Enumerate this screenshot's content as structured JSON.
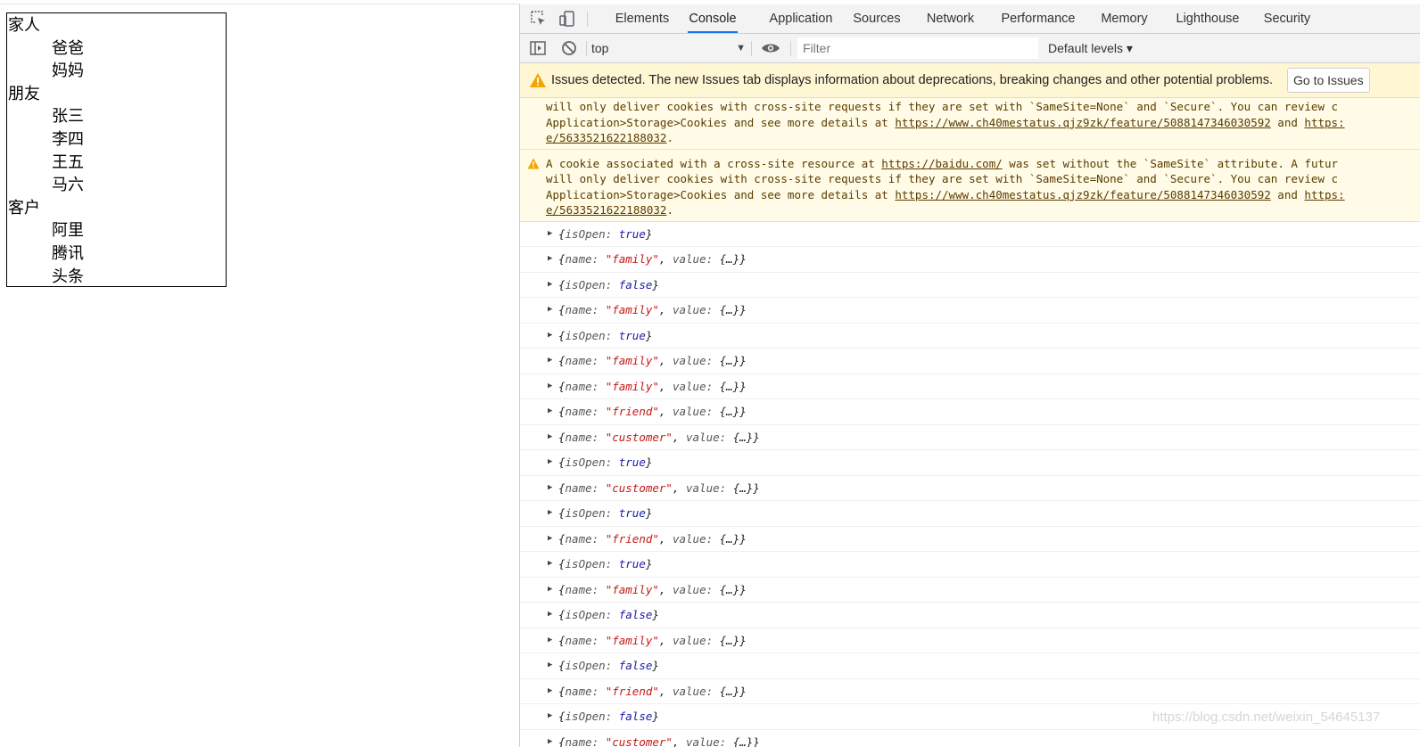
{
  "page": {
    "tree": {
      "groups": [
        {
          "label": "家人",
          "members": [
            "爸爸",
            "妈妈"
          ]
        },
        {
          "label": "朋友",
          "members": [
            "张三",
            "李四",
            "王五",
            "马六"
          ]
        },
        {
          "label": "客户",
          "members": [
            "阿里",
            "腾讯",
            "头条"
          ]
        }
      ]
    }
  },
  "devtools": {
    "tabs": [
      "Elements",
      "Console",
      "Application",
      "Sources",
      "Network",
      "Performance",
      "Memory",
      "Lighthouse",
      "Security"
    ],
    "active_tab": "Console",
    "toolbar": {
      "context": "top",
      "filter_placeholder": "Filter",
      "levels": "Default levels ▾"
    },
    "issues_bar": {
      "text": "Issues detected. The new Issues tab displays information about deprecations, breaking changes and other potential problems.",
      "button": "Go to Issues"
    },
    "warnings": [
      {
        "lines": [
          "will only deliver cookies with cross-site requests if they are set with `SameSite=None` and `Secure`. You can review c",
          "Application>Storage>Cookies and see more details at |https://www.ch40mestatus.qjz9zk/feature/5088147346030592| and |https:",
          "|e/5633521622188032|."
        ]
      },
      {
        "lines": [
          "A cookie associated with a cross-site resource at |https://baidu.com/| was set without the `SameSite` attribute. A futur",
          "will only deliver cookies with cross-site requests if they are set with `SameSite=None` and `Secure`. You can review c",
          "Application>Storage>Cookies and see more details at |https://www.ch40mestatus.qjz9zk/feature/5088147346030592| and |https:",
          "|e/5633521622188032|."
        ]
      }
    ],
    "console_rows": [
      {
        "isOpen": "true"
      },
      {
        "name": "\"family\""
      },
      {
        "isOpen": "false"
      },
      {
        "name": "\"family\""
      },
      {
        "isOpen": "true"
      },
      {
        "name": "\"family\""
      },
      {
        "name": "\"family\""
      },
      {
        "name": "\"friend\""
      },
      {
        "name": "\"customer\""
      },
      {
        "isOpen": "true"
      },
      {
        "name": "\"customer\""
      },
      {
        "isOpen": "true"
      },
      {
        "name": "\"friend\""
      },
      {
        "isOpen": "true"
      },
      {
        "name": "\"family\""
      },
      {
        "isOpen": "false"
      },
      {
        "name": "\"family\""
      },
      {
        "isOpen": "false"
      },
      {
        "name": "\"friend\""
      },
      {
        "isOpen": "false"
      },
      {
        "name": "\"customer\""
      }
    ],
    "tokens": {
      "isOpen_key": "isOpen",
      "name_key": "name",
      "value_key": "value",
      "collapsed": "{…}",
      "expand_arrow": "▶"
    }
  },
  "watermark": "https://blog.csdn.net/weixin_54645137",
  "icons": [
    "inspect-icon",
    "device-toggle-icon",
    "sidebar-toggle-icon",
    "clear-console-icon",
    "eye-icon",
    "warning-icon"
  ],
  "colors": {
    "active_tab_underline": "#1a73e8",
    "string": "#c41a16",
    "boolean": "#1a1aa6",
    "warning_bg": "#fffbe6"
  }
}
